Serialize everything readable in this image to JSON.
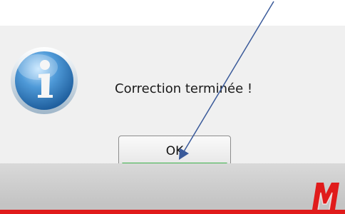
{
  "dialog": {
    "message": "Correction terminée !",
    "ok_label": "OK",
    "icon": "information-icon",
    "focus_color": "#3cb34a"
  },
  "branding": {
    "logo_text": "M",
    "accent_color": "#e01b1b"
  },
  "annotation": {
    "type": "arrow",
    "color": "#3a5a9a"
  }
}
